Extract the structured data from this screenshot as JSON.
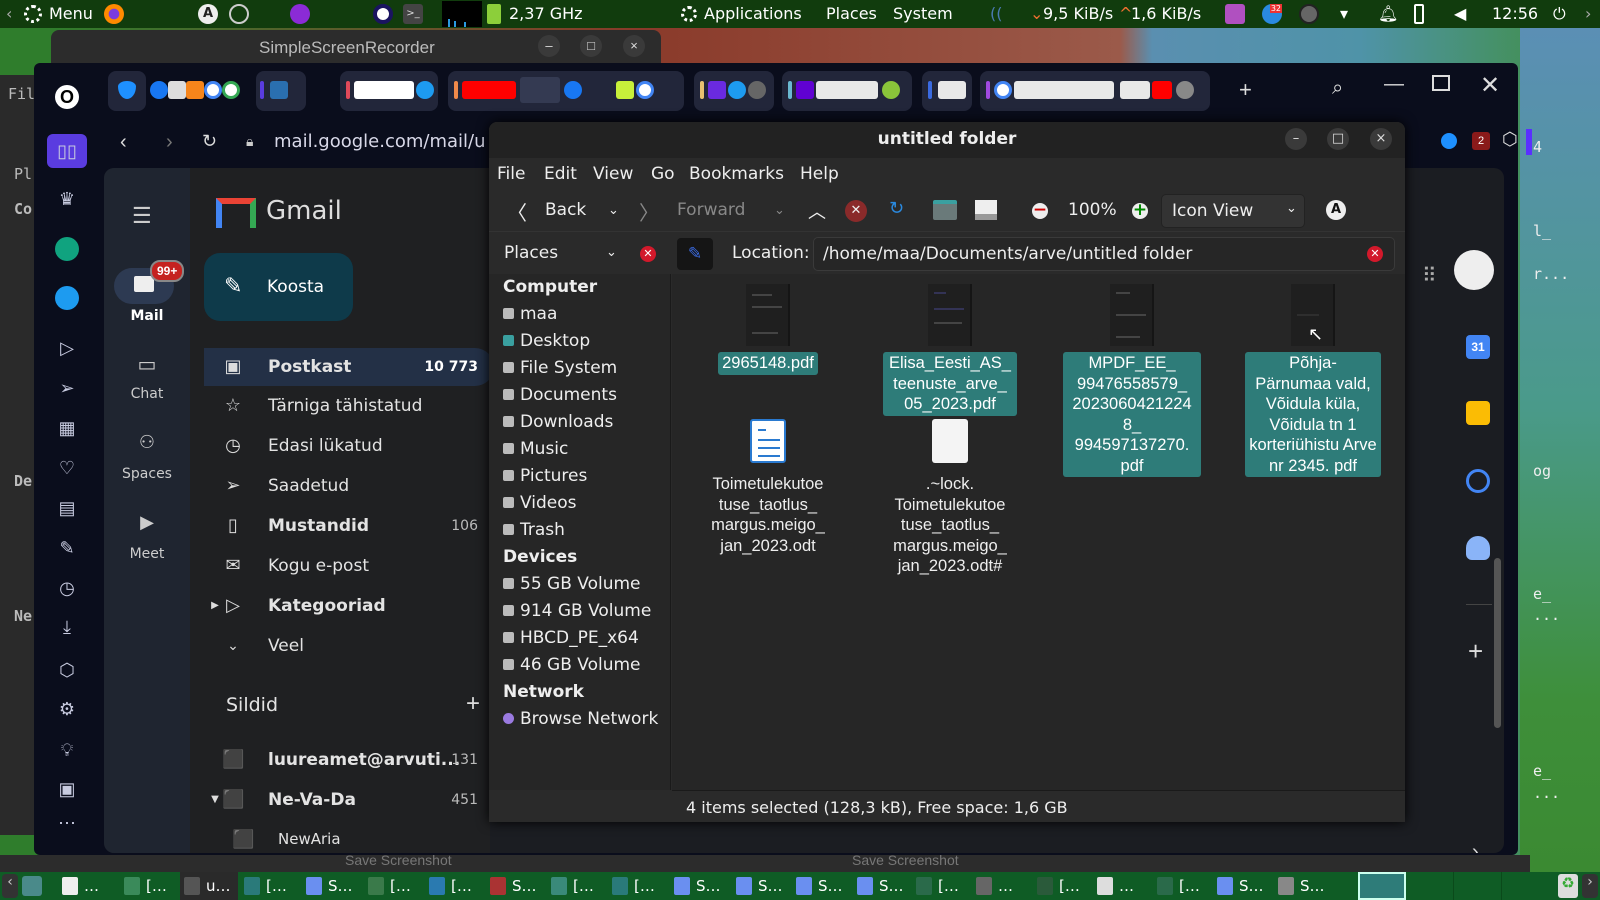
{
  "top_panel": {
    "menu": "Menu",
    "cpu_freq": "2,37 GHz",
    "applications": "Applications",
    "places": "Places",
    "system": "System",
    "net_down": "9,5 KiB/s",
    "net_up": "1,6 KiB/s",
    "clock": "12:56",
    "notification_count": "32"
  },
  "background_window": {
    "title": "SimpleScreenRecorder"
  },
  "desktop_fragments": [
    "4",
    "l_",
    "r...",
    "og",
    "e_",
    "...",
    "e_",
    "...",
    "File",
    "Pl",
    "Co",
    "De",
    "Ne"
  ],
  "browser": {
    "url": "mail.google.com/mail/u",
    "extension_badge": "2"
  },
  "gmail": {
    "logo": "Gmail",
    "rail": [
      {
        "label": "Mail",
        "badge": "99+"
      },
      {
        "label": "Chat"
      },
      {
        "label": "Spaces"
      },
      {
        "label": "Meet"
      }
    ],
    "compose": "Koosta",
    "nav": [
      {
        "label": "Postkast",
        "count": "10 773",
        "bold": true
      },
      {
        "label": "Tärniga tähistatud"
      },
      {
        "label": "Edasi lükatud"
      },
      {
        "label": "Saadetud"
      },
      {
        "label": "Mustandid",
        "count": "106",
        "bold": true
      },
      {
        "label": "Kogu e-post"
      },
      {
        "label": "Kategooriad",
        "bold": true
      },
      {
        "label": "Veel"
      }
    ],
    "labels_title": "Sildid",
    "labels": [
      {
        "label": "luureamet@arvuti...",
        "count": "131"
      },
      {
        "label": "Ne-Va-Da",
        "count": "451"
      },
      {
        "label": "NewAria"
      }
    ],
    "calendar_day": "31"
  },
  "file_manager": {
    "title": "untitled folder",
    "menu": [
      "File",
      "Edit",
      "View",
      "Go",
      "Bookmarks",
      "Help"
    ],
    "toolbar": {
      "back": "Back",
      "forward": "Forward",
      "zoom": "100%",
      "view_mode": "Icon View"
    },
    "side_pane_mode": "Places",
    "location_label": "Location:",
    "location": "/home/maa/Documents/arve/untitled folder",
    "places": {
      "computer_title": "Computer",
      "computer": [
        "maa",
        "Desktop",
        "File System",
        "Documents",
        "Downloads",
        "Music",
        "Pictures",
        "Videos",
        "Trash"
      ],
      "devices_title": "Devices",
      "devices": [
        "55 GB Volume",
        "914 GB Volume",
        "HBCD_PE_x64",
        "46 GB Volume"
      ],
      "network_title": "Network",
      "network": [
        "Browse Network"
      ]
    },
    "files": [
      {
        "name": "2965148.pdf",
        "selected": true,
        "type": "pdf"
      },
      {
        "name": "Elisa_Eesti_AS_ teenuste_arve_ 05_2023.pdf",
        "selected": true,
        "type": "pdf"
      },
      {
        "name": "MPDF_EE_ 99476558579_ 2023060421224 8_ 994597137270. pdf",
        "selected": true,
        "type": "pdf"
      },
      {
        "name": "Põhja- Pärnumaa vald, Võidula küla, Võidula tn 1 korteriühistu Arve nr 2345. pdf",
        "selected": true,
        "type": "pdf"
      },
      {
        "name": "Toimetulekutoe tuse_taotlus_ margus.meigo_ jan_2023.odt",
        "selected": false,
        "type": "odt"
      },
      {
        "name": ".~lock. Toimetulekutoe tuse_taotlus_ margus.meigo_ jan_2023.odt#",
        "selected": false,
        "type": "lock"
      }
    ],
    "status": "4 items selected (128,3 kB), Free space: 1,6 GB"
  },
  "behind_window_title": "Save Screenshot",
  "taskbar": [
    "…",
    "[…",
    "u…",
    "[…",
    "S…",
    "[…",
    "[…",
    "S…",
    "[…",
    "[…",
    "S…",
    "S…",
    "S…",
    "S…",
    "[…",
    "…",
    "[…",
    "…",
    "[…",
    "S…",
    "S…"
  ],
  "colors": {
    "panel": "#113c0d",
    "taskbar": "#0f5c25",
    "selection": "#2e7c79",
    "gmail_compose": "#0e3a4a"
  }
}
